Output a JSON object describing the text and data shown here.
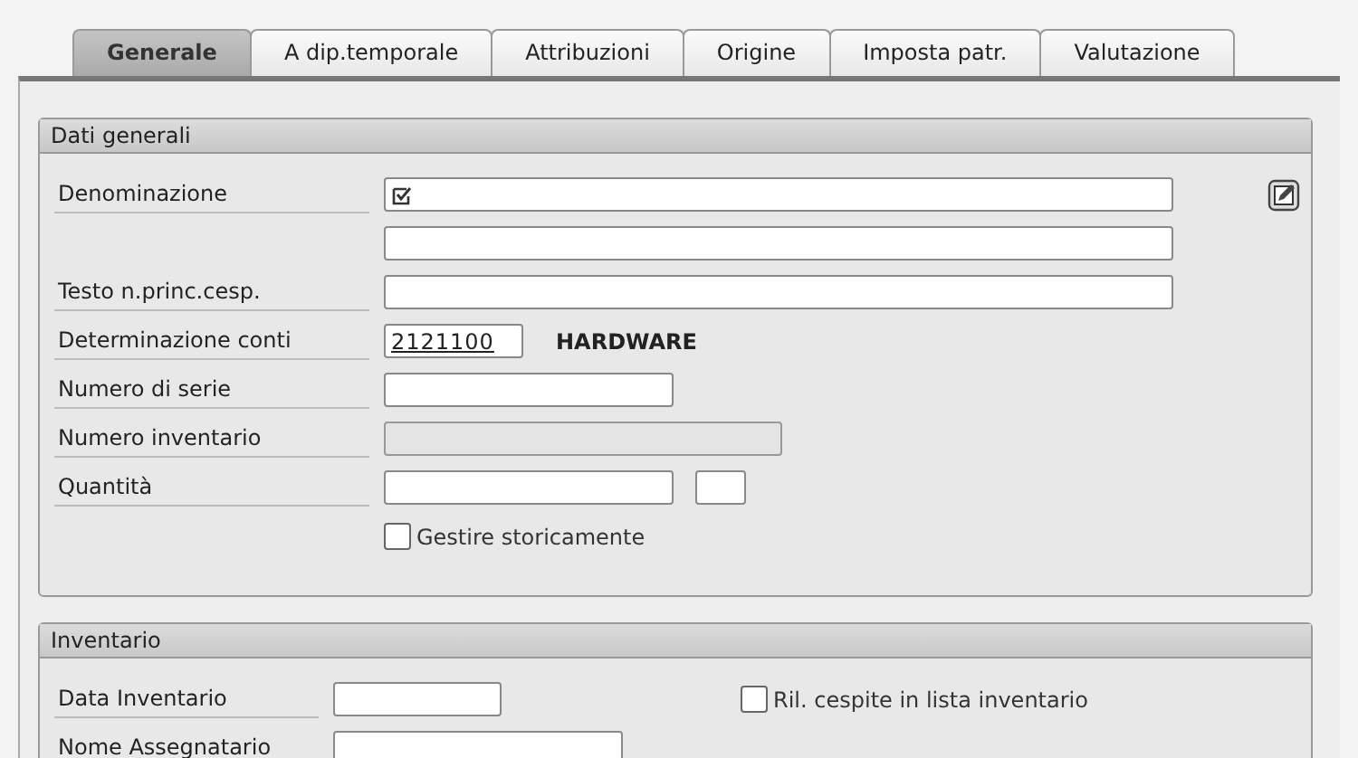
{
  "tabs": [
    {
      "label": "Generale",
      "selected": true
    },
    {
      "label": "A dip.temporale",
      "selected": false
    },
    {
      "label": "Attribuzioni",
      "selected": false
    },
    {
      "label": "Origine",
      "selected": false
    },
    {
      "label": "Imposta patr.",
      "selected": false
    },
    {
      "label": "Valutazione",
      "selected": false
    }
  ],
  "sections": [
    {
      "title": "Dati generali",
      "rows": [
        {
          "label": "Denominazione",
          "items": [
            {
              "kind": "field",
              "disabled": false,
              "input_help": true
            }
          ]
        },
        {
          "items": [
            {
              "kind": "field",
              "disabled": false,
              "input_help": false
            }
          ]
        },
        {
          "label": "Testo n.princ.cesp.",
          "items": [
            {
              "kind": "field",
              "disabled": false,
              "input_help": false
            }
          ]
        },
        {
          "label": "Determinazione conti",
          "items": [
            {
              "kind": "field",
              "value": "2121100",
              "disabled": false,
              "input_help": false
            },
            {
              "kind": "text",
              "text": "HARDWARE"
            }
          ]
        },
        {
          "label": "Numero di serie",
          "items": [
            {
              "kind": "field",
              "disabled": false,
              "input_help": false
            }
          ]
        },
        {
          "label": "Numero inventario",
          "items": [
            {
              "kind": "field",
              "disabled": true,
              "input_help": false
            }
          ]
        },
        {
          "label": "Quantità",
          "items": [
            {
              "kind": "field",
              "disabled": false,
              "input_help": false
            },
            {
              "kind": "field",
              "disabled": false,
              "input_help": false
            }
          ]
        },
        {
          "items": [
            {
              "kind": "checkbox",
              "label": "Gestire storicamente",
              "checked": false
            }
          ]
        }
      ]
    },
    {
      "title": "Inventario",
      "rows": [
        {
          "label": "Data Inventario",
          "items": [
            {
              "kind": "field",
              "disabled": false,
              "input_help": false
            },
            {
              "kind": "checkbox",
              "label": "Ril. cespite in lista inventario",
              "checked": false
            }
          ]
        },
        {
          "label": "Nome Assegnatario",
          "items": [
            {
              "kind": "field",
              "disabled": false,
              "input_help": false
            }
          ]
        }
      ]
    }
  ]
}
